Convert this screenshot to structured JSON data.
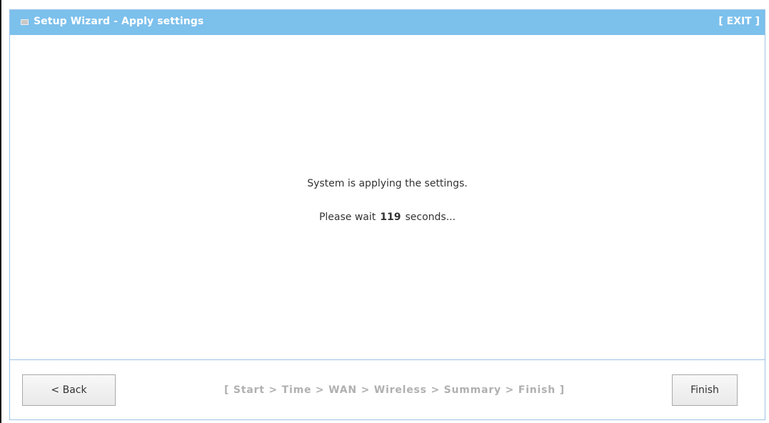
{
  "header": {
    "title": "Setup Wizard - Apply settings",
    "exit_label": "[ EXIT ]"
  },
  "main": {
    "status_message": "System is applying the settings.",
    "wait_prefix": "Please wait",
    "wait_seconds": "119",
    "wait_suffix": "seconds..."
  },
  "footer": {
    "back_label": "< Back",
    "steps_breadcrumb": "[ Start > Time > WAN > Wireless > Summary > Finish ]",
    "finish_label": "Finish"
  }
}
